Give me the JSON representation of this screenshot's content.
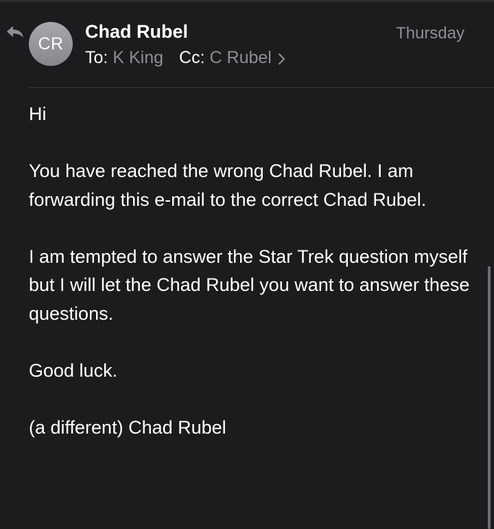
{
  "message": {
    "sender_initials": "CR",
    "sender_name": "Chad Rubel",
    "date": "Thursday",
    "to_label": "To:",
    "to_value": "K King",
    "cc_label": "Cc:",
    "cc_value": "C Rubel"
  },
  "body": {
    "paragraphs": [
      "Hi",
      "You have reached the wrong Chad Rubel. I am forwarding this e-mail to the correct Chad Rubel.",
      "I am tempted to answer the Star Trek question myself but I will let the Chad Rubel you want to answer these questions.",
      "Good luck.",
      "(a different) Chad Rubel"
    ]
  },
  "icons": {
    "reply": "reply-arrow-icon",
    "expand": "chevron-right-icon"
  },
  "colors": {
    "background": "#1c1c1e",
    "secondary_text": "#8e8e93",
    "avatar": "#9a9aa0"
  }
}
